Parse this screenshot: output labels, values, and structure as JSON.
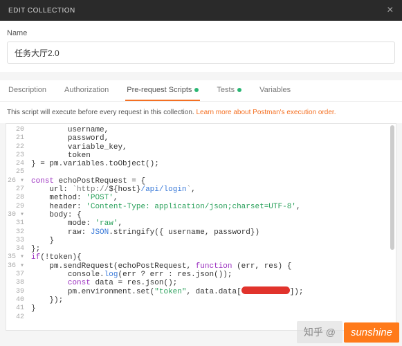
{
  "header": {
    "title": "EDIT COLLECTION"
  },
  "form": {
    "name_label": "Name",
    "name_value": "任务大厅2.0"
  },
  "tabs": {
    "description": "Description",
    "authorization": "Authorization",
    "prerequest": "Pre-request Scripts",
    "tests": "Tests",
    "variables": "Variables"
  },
  "hint": {
    "text": "This script will execute before every request in this collection. ",
    "link": "Learn more about Postman's execution order."
  },
  "code": {
    "lines": [
      {
        "n": 20,
        "t": "        username,"
      },
      {
        "n": 21,
        "t": "        password,"
      },
      {
        "n": 22,
        "t": "        variable_key,"
      },
      {
        "n": 23,
        "t": "        token"
      },
      {
        "n": 24,
        "t": "} = pm.variables.toObject();"
      },
      {
        "n": 25,
        "t": ""
      },
      {
        "n": 26,
        "t": "const echoPostRequest = {",
        "fold": true
      },
      {
        "n": 27,
        "t": "    url: `http://${host}/api/login`,",
        "url": true
      },
      {
        "n": 28,
        "t": "    method: 'POST',",
        "str": "'POST'"
      },
      {
        "n": 29,
        "t": "    header: 'Content-Type: application/json;charset=UTF-8',",
        "str": "'Content-Type: application/json;charset=UTF-8'"
      },
      {
        "n": 30,
        "t": "    body: {",
        "fold": true
      },
      {
        "n": 31,
        "t": "        mode: 'raw',",
        "str": "'raw'"
      },
      {
        "n": 32,
        "t": "        raw: JSON.stringify({ username, password})"
      },
      {
        "n": 33,
        "t": "    }"
      },
      {
        "n": 34,
        "t": "};"
      },
      {
        "n": 35,
        "t": "if(!token){",
        "fold": true
      },
      {
        "n": 36,
        "t": "    pm.sendRequest(echoPostRequest, function (err, res) {",
        "fold": true
      },
      {
        "n": 37,
        "t": "        console.log(err ? err : res.json());"
      },
      {
        "n": 38,
        "t": "        const data = res.json();"
      },
      {
        "n": 39,
        "t": "        pm.environment.set(\"token\", data.data[REDACTED]);",
        "redact": true
      },
      {
        "n": 40,
        "t": "    });"
      },
      {
        "n": 41,
        "t": "}"
      },
      {
        "n": 42,
        "t": ""
      }
    ]
  },
  "watermark": {
    "left": "知乎 @",
    "right": "sunshine"
  }
}
